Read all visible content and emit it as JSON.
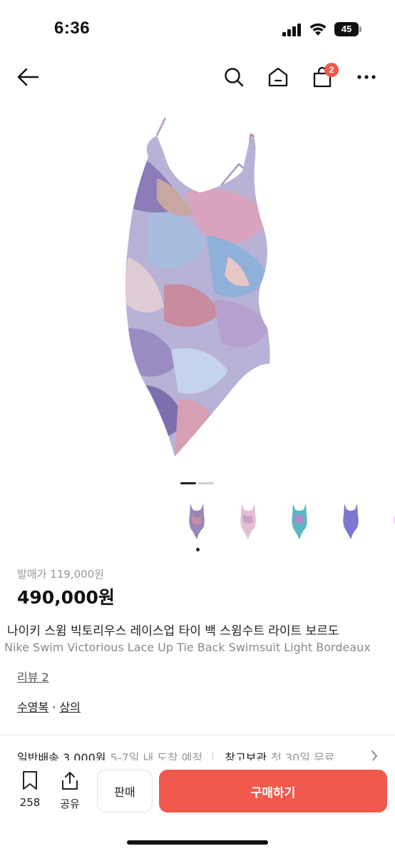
{
  "status_bar": {
    "time": "6:36",
    "battery": "45"
  },
  "nav": {
    "cart_count": "2"
  },
  "product": {
    "release_price": "발매가 119,000원",
    "price": "490,000원",
    "title_ko": "나이키 스윔 빅토리우스 레이스업 타이 백 스윔수트 라이트 보르도",
    "title_en": "Nike Swim Victorious Lace Up Tie Back Swimsuit Light Bordeaux",
    "reviews": "리뷰 2",
    "category": {
      "main": "수영복",
      "separator": " · ",
      "sub": "상의"
    }
  },
  "shipping": {
    "label": "일반배송 3,000원",
    "eta": "5-7일 내 도착 예정",
    "storage": "창고보관",
    "storage_note": "첫 30일 무료"
  },
  "bottom_bar": {
    "bookmark_count": "258",
    "share_label": "공유",
    "sell_label": "판매",
    "buy_label": "구매하기"
  },
  "colors": {
    "accent": "#f05a4d",
    "text": "#111111",
    "muted": "#9a9a9a"
  }
}
